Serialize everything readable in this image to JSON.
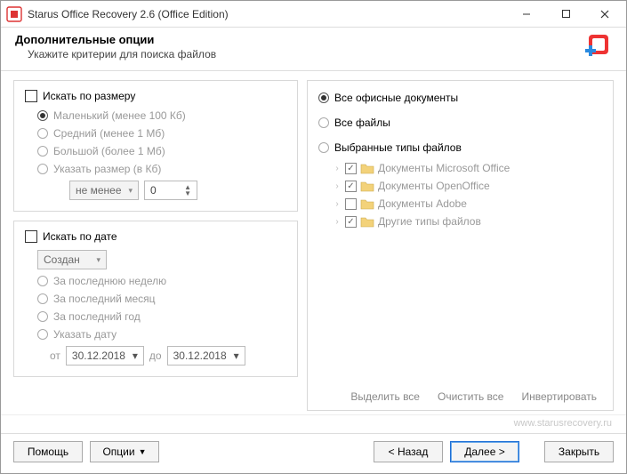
{
  "window": {
    "title": "Starus Office Recovery 2.6 (Office Edition)"
  },
  "header": {
    "title": "Дополнительные опции",
    "subtitle": "Укажите критерии для поиска файлов"
  },
  "size_panel": {
    "checkbox_label": "Искать по размеру",
    "small": "Маленький (менее 100 Кб)",
    "medium": "Средний (менее 1 Мб)",
    "large": "Большой (более 1 Мб)",
    "custom": "Указать размер (в Кб)",
    "sel_value": "не менее",
    "num_value": "0"
  },
  "date_panel": {
    "checkbox_label": "Искать по дате",
    "sel_value": "Создан",
    "week": "За последнюю неделю",
    "month": "За последний месяц",
    "year": "За последний год",
    "custom": "Указать дату",
    "from_label": "от",
    "from_value": "30.12.2018",
    "to_label": "до",
    "to_value": "30.12.2018"
  },
  "types_panel": {
    "opt_office": "Все офисные документы",
    "opt_all": "Все файлы",
    "opt_selected": "Выбранные типы файлов",
    "tree": [
      {
        "checked": true,
        "label": "Документы Microsoft Office"
      },
      {
        "checked": true,
        "label": "Документы OpenOffice"
      },
      {
        "checked": false,
        "label": "Документы Adobe"
      },
      {
        "checked": true,
        "label": "Другие типы файлов"
      }
    ],
    "select_all": "Выделить все",
    "clear_all": "Очистить все",
    "invert": "Инвертировать"
  },
  "watermark": "www.starusrecovery.ru",
  "footer": {
    "help": "Помощь",
    "options": "Опции",
    "back": "< Назад",
    "next": "Далее >",
    "close": "Закрыть"
  }
}
